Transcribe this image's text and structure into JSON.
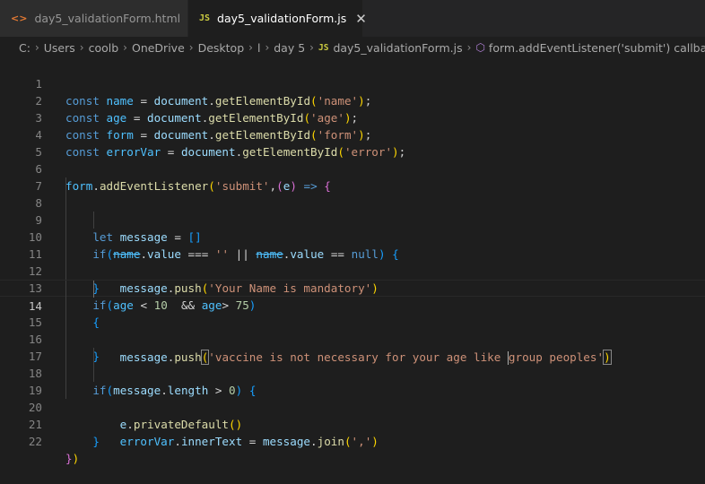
{
  "tabs": [
    {
      "icon": "<>",
      "label": "day5_validationForm.html",
      "active": false
    },
    {
      "icon": "JS",
      "label": "day5_validationForm.js",
      "active": true,
      "close": "✕"
    }
  ],
  "breadcrumb": {
    "items": [
      "C:",
      "Users",
      "coolb",
      "OneDrive",
      "Desktop",
      "l",
      "day 5",
      "day5_validationForm.js",
      "form.addEventListener('submit') callback"
    ],
    "separator": "›",
    "file_icon": "JS"
  },
  "editor": {
    "language": "javascript",
    "current_line": 14,
    "line_numbers": [
      "1",
      "2",
      "3",
      "4",
      "5",
      "6",
      "7",
      "8",
      "9",
      "10",
      "11",
      "12",
      "13",
      "14",
      "15",
      "16",
      "17",
      "18",
      "19",
      "20",
      "21",
      "22"
    ],
    "lines": [
      "const name = document.getElementById('name');",
      "const age = document.getElementById('age');",
      "const form = document.getElementById('form');",
      "const errorVar = document.getElementById('error');",
      "",
      "form.addEventListener('submit',(e) => {",
      "",
      "    let message = []",
      "    if(name.value === '' || name.value == null) {",
      "        message.push('Your Name is mandatory')",
      "    }",
      "    if(age < 10  && age> 75)",
      "    {",
      "        message.push('vaccine is not necessary for your age like group peoples')",
      "    }",
      "",
      "    if(message.length > 0) {",
      "        e.privateDefault()",
      "        errorVar.innerText = message.join(',')",
      "    }",
      "",
      "})"
    ]
  }
}
